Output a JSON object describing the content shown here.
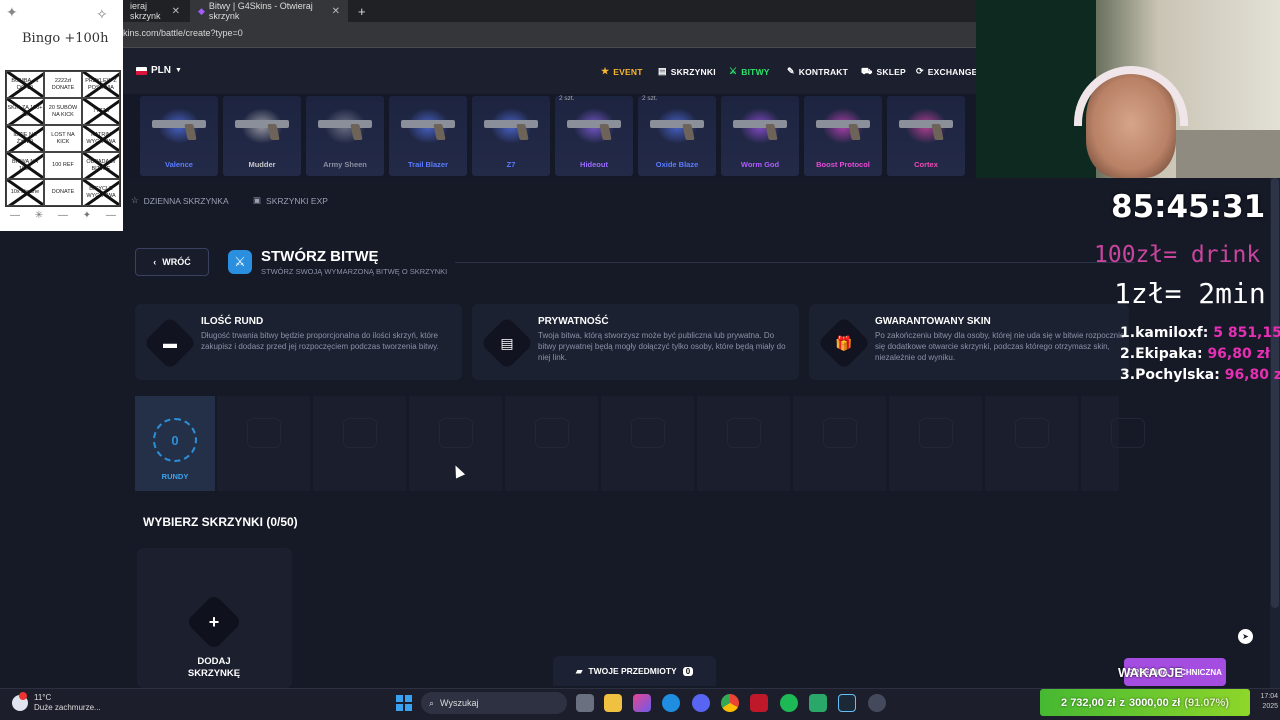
{
  "browser": {
    "tabs": [
      {
        "title": "ieraj skrzynk",
        "active": false
      },
      {
        "title": "Bitwy | G4Skins - Otwieraj skrzynk",
        "active": true
      }
    ],
    "url": "kins.com/battle/create?type=0"
  },
  "header": {
    "currency": "PLN",
    "nav": [
      {
        "label": "EVENT",
        "icon": "star-icon",
        "color": "#f7b731"
      },
      {
        "label": "SKRZYNKI",
        "icon": "cases-icon",
        "color": "#ffffff"
      },
      {
        "label": "BITWY",
        "icon": "battle-icon",
        "color": "#2de36a"
      },
      {
        "label": "KONTRAKT",
        "icon": "pen-icon",
        "color": "#ffffff"
      },
      {
        "label": "SKLEP",
        "icon": "cart-icon",
        "color": "#ffffff"
      },
      {
        "label": "EXCHANGER",
        "icon": "exchange-icon",
        "color": "#ffffff"
      }
    ]
  },
  "cases": [
    {
      "name": "Valence",
      "color": "#5a7cff",
      "qty": ""
    },
    {
      "name": "Mudder",
      "color": "#c8c8c8",
      "qty": ""
    },
    {
      "name": "Army Sheen",
      "color": "#8b8fa0",
      "qty": ""
    },
    {
      "name": "Trail Blazer",
      "color": "#5a7cff",
      "qty": ""
    },
    {
      "name": "Z7",
      "color": "#5a7cff",
      "qty": ""
    },
    {
      "name": "Hideout",
      "color": "#9a6cff",
      "qty": "2 szt."
    },
    {
      "name": "Oxide Blaze",
      "color": "#5a7cff",
      "qty": "2 szt."
    },
    {
      "name": "Worm God",
      "color": "#b15cff",
      "qty": ""
    },
    {
      "name": "Boost Protocol",
      "color": "#e94ad6",
      "qty": ""
    },
    {
      "name": "Cortex",
      "color": "#f04ab5",
      "qty": ""
    }
  ],
  "subnav": {
    "daily": "DZIENNA SKRZYNKA",
    "exp": "SKRZYNKI EXP"
  },
  "page": {
    "back": "WRÓĆ",
    "title": "STWÓRZ BITWĘ",
    "subtitle": "STWÓRZ SWOJĄ WYMARZONĄ BITWĘ O SKRZYNKI"
  },
  "info_cards": [
    {
      "title": "ILOŚĆ RUND",
      "desc": "Długość trwania bitwy będzie proporcjonalna do ilości skrzyń, które zakupisz i dodasz przed jej rozpoczęciem podczas tworzenia bitwy.",
      "icon": "chest-icon"
    },
    {
      "title": "PRYWATNOŚĆ",
      "desc": "Twoja bitwa, którą stworzysz może być publiczna lub prywatna. Do bitwy prywatnej będą mogły dołączyć tylko osoby, które będą miały do niej link.",
      "icon": "document-icon"
    },
    {
      "title": "GWARANTOWANY SKIN",
      "desc": "Po zakończeniu bitwy dla osoby, której nie uda się w bitwie rozpocznie się dodatkowe otwarcie skrzynki, podczas którego otrzymasz skin, niezależnie od wyniku.",
      "icon": "gift-icon"
    }
  ],
  "rounds": {
    "count": "0",
    "label": "RUNDY"
  },
  "select": {
    "title": "WYBIERZ SKRZYNKI (0/50)",
    "add_label_1": "DODAJ",
    "add_label_2": "SKRZYNKĘ"
  },
  "footer": {
    "my_items": "TWOJE PRZEDMIOTY",
    "my_items_count": "0",
    "tech": "PRZERWA TECHNICZNA"
  },
  "overlay": {
    "bingo_title": "Bingo +100h",
    "bingo_cells": [
      "BOMBA +1 DO 10",
      "2222zł DONATE",
      "PRZYLEW Z POSHWIA",
      "SKIN ZA 100+ ZŁ",
      "20 SUBÓW NA KICK",
      "7777zł",
      "IDZIE NA ŻYWO",
      "LOST NA KICK",
      "KATRIN WYGRYWA",
      "BITWA NA 1000",
      "100 REF",
      "ODPADA W BITWIE",
      "10x ukraine",
      "DONATE",
      "BICYCLE WYGRYWA"
    ],
    "timer": "85:45:31",
    "line1": "100zł= drink",
    "line2": "1zł= 2min",
    "leaderboard": [
      {
        "rank": "1.",
        "name": "kamiloxf:",
        "amount": "5 851,15 zł"
      },
      {
        "rank": "2.",
        "name": "Ekipaka:",
        "amount": "96,80 zł"
      },
      {
        "rank": "3.",
        "name": "Pochylska:",
        "amount": "96,80 zł"
      }
    ],
    "wakacje": "WAKACJE",
    "goal_current": "2 732,00 zł",
    "goal_of": "z",
    "goal_target": "3000,00 zł",
    "goal_pct": "(91.07%)",
    "goal_fraction": 0.9107
  },
  "taskbar": {
    "weather_temp": "11°C",
    "weather_desc": "Duże zachmurze...",
    "search": "Wyszukaj",
    "time": "17:04",
    "date": "2025"
  }
}
